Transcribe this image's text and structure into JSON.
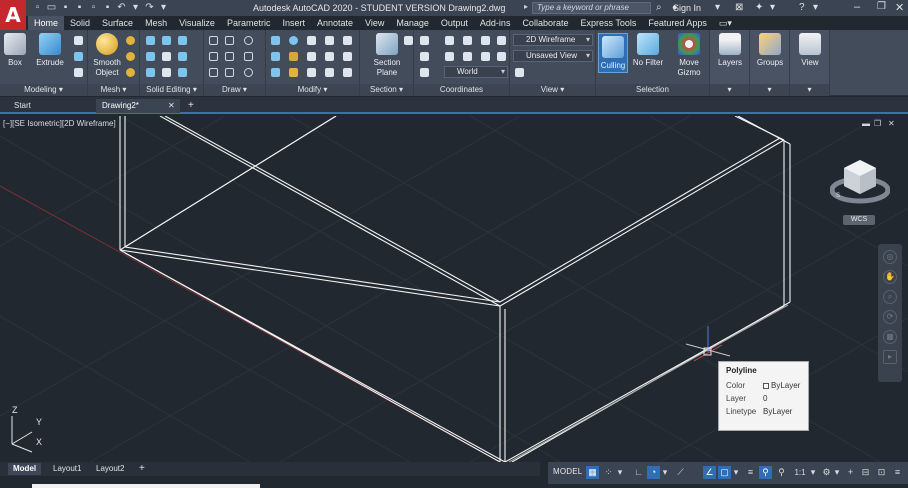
{
  "app": {
    "logo": "A",
    "title": "Autodesk AutoCAD 2020 - STUDENT VERSION    Drawing2.dwg",
    "search_placeholder": "Type a keyword or phrase",
    "sign_in": "Sign In"
  },
  "ribbon_tabs": [
    "Home",
    "Solid",
    "Surface",
    "Mesh",
    "Visualize",
    "Parametric",
    "Insert",
    "Annotate",
    "View",
    "Manage",
    "Output",
    "Add-ins",
    "Collaborate",
    "Express Tools",
    "Featured Apps"
  ],
  "ribbon": {
    "modeling": {
      "label": "Modeling",
      "box": "Box",
      "extrude": "Extrude"
    },
    "mesh": {
      "label": "Mesh",
      "smooth_object": "Smooth Object"
    },
    "solid_editing": {
      "label": "Solid Editing"
    },
    "draw": {
      "label": "Draw"
    },
    "modify": {
      "label": "Modify"
    },
    "section": {
      "label": "Section",
      "section_plane": "Section Plane"
    },
    "coordinates": {
      "label": "Coordinates",
      "ucs": "World"
    },
    "view": {
      "label": "View",
      "visual_style": "2D Wireframe",
      "named_view": "Unsaved View"
    },
    "selection": {
      "label": "Selection",
      "culling": "Culling",
      "no_filter": "No Filter",
      "move_gizmo": "Move Gizmo"
    },
    "layers": "Layers",
    "groups": "Groups",
    "view_btn": "View"
  },
  "file_tabs": [
    "Start",
    "Drawing2*"
  ],
  "viewport": {
    "label": "[−][SE Isometric][2D Wireframe]",
    "wcs": "WCS",
    "ucs_y": "Y",
    "ucs_x": "X",
    "ucs_z": "Z"
  },
  "tooltip": {
    "title": "Polyline",
    "rows": [
      {
        "key": "Color",
        "value": "ByLayer"
      },
      {
        "key": "Layer",
        "value": "0"
      },
      {
        "key": "Linetype",
        "value": "ByLayer"
      }
    ]
  },
  "layout_tabs": [
    "Model",
    "Layout1",
    "Layout2"
  ],
  "statusbar": {
    "model": "MODEL",
    "scale": "1:1"
  },
  "colors": {
    "accent": "#2f6db5",
    "viewport_bg": "#212830",
    "ribbon_bg": "#434c5b",
    "logo_red": "#c4282f"
  }
}
